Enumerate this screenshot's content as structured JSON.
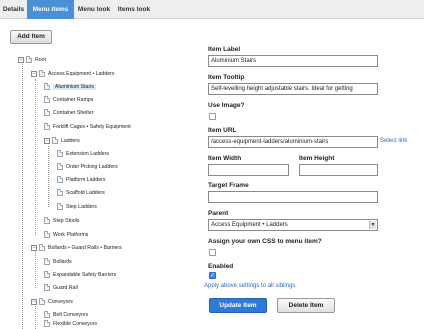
{
  "tabs": [
    {
      "label": "Details"
    },
    {
      "label": "Menu items"
    },
    {
      "label": "Menu look"
    },
    {
      "label": "Items look"
    }
  ],
  "active_tab": "Menu items",
  "add_item_label": "Add Item",
  "tree": {
    "root": "Root",
    "items": [
      "Access Equipment • Ladders",
      "Aluminium Stairs",
      "Container Ramps",
      "Container Shelter",
      "Forklift Cages • Safety Equipment",
      "Ladders",
      "Extension Ladders",
      "Order Picking Ladders",
      "Platform Ladders",
      "Scaffold Ladders",
      "Step Ladders",
      "Step Stools",
      "Work Platforms",
      "Bollards • Guard Rails • Barriers",
      "Bollards",
      "Expandable Safety Barriers",
      "Guard Rail",
      "Conveyors",
      "Belt Conveyors",
      "Flexible Conveyors"
    ],
    "selected": "Aluminium Stairs"
  },
  "form": {
    "item_label": {
      "label": "Item Label",
      "value": "Aluminium Stairs"
    },
    "item_tooltip": {
      "label": "Item Tooltip",
      "value": "Self-levelling height adjustable stairs. Ideal for getting"
    },
    "use_image": {
      "label": "Use Image?",
      "checked": false
    },
    "item_url": {
      "label": "Item URL",
      "value": "/access-equipment-ladders/aluminium-stairs",
      "select_link": "Select link"
    },
    "item_width": {
      "label": "Item Width",
      "value": ""
    },
    "item_height": {
      "label": "Item Height",
      "value": ""
    },
    "target_frame": {
      "label": "Target Frame",
      "value": ""
    },
    "parent": {
      "label": "Parent",
      "value": "Access Equipment • Ladders"
    },
    "assign_css": {
      "label": "Assign your own CSS to menu item?",
      "checked": false
    },
    "enabled": {
      "label": "Enabled",
      "checked": true
    },
    "apply_link": "Apply above settings to all siblings",
    "update_button": "Update Item",
    "delete_button": "Delete Item"
  },
  "colors": {
    "accent": "#4a90d6",
    "primary_button": "#2d7bd8",
    "link": "#2a6db8"
  }
}
